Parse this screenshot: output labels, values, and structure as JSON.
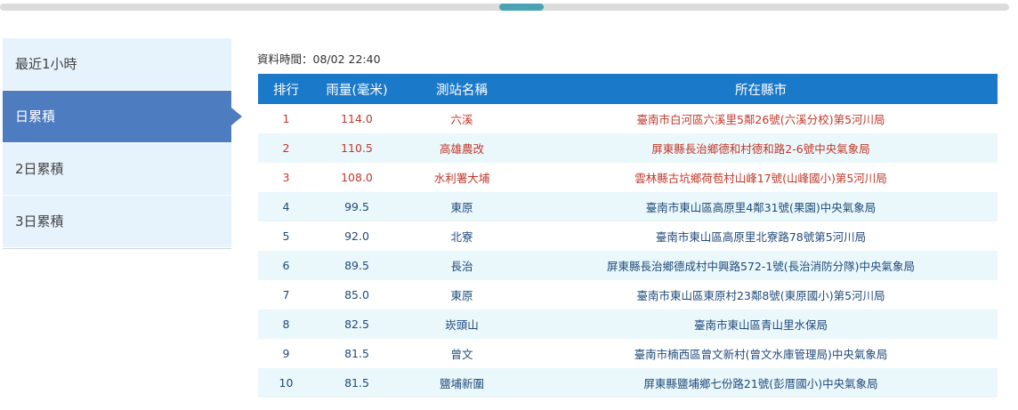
{
  "sidebar": {
    "items": [
      {
        "label": "最近1小時",
        "active": false
      },
      {
        "label": "日累積",
        "active": true
      },
      {
        "label": "2日累積",
        "active": false
      },
      {
        "label": "3日累積",
        "active": false
      }
    ]
  },
  "data_time": "資料時間：08/02 22:40",
  "table": {
    "headers": [
      "排行",
      "雨量(毫米)",
      "測站名稱",
      "所在縣市"
    ],
    "rows": [
      {
        "rank": "1",
        "rain": "114.0",
        "station": "六溪",
        "location": "臺南市白河區六溪里5鄰26號(六溪分校)第5河川局",
        "highlight": true
      },
      {
        "rank": "2",
        "rain": "110.5",
        "station": "高雄農改",
        "location": "屏東縣長治鄉德和村德和路2-6號中央氣象局",
        "highlight": true
      },
      {
        "rank": "3",
        "rain": "108.0",
        "station": "水利署大埔",
        "location": "雲林縣古坑鄉荷苞村山峰17號(山峰國小)第5河川局",
        "highlight": true
      },
      {
        "rank": "4",
        "rain": "99.5",
        "station": "東原",
        "location": "臺南市東山區高原里4鄰31號(果園)中央氣象局",
        "highlight": false
      },
      {
        "rank": "5",
        "rain": "92.0",
        "station": "北寮",
        "location": "臺南市東山區高原里北寮路78號第5河川局",
        "highlight": false
      },
      {
        "rank": "6",
        "rain": "89.5",
        "station": "長治",
        "location": "屏東縣長治鄉德成村中興路572-1號(長治消防分隊)中央氣象局",
        "highlight": false
      },
      {
        "rank": "7",
        "rain": "85.0",
        "station": "東原",
        "location": "臺南市東山區東原村23鄰8號(東原國小)第5河川局",
        "highlight": false
      },
      {
        "rank": "8",
        "rain": "82.5",
        "station": "崁頭山",
        "location": "臺南市東山區青山里水保局",
        "highlight": false
      },
      {
        "rank": "9",
        "rain": "81.5",
        "station": "曾文",
        "location": "臺南市楠西區曾文新村(曾文水庫管理局)中央氣象局",
        "highlight": false
      },
      {
        "rank": "10",
        "rain": "81.5",
        "station": "鹽埔新圍",
        "location": "屏東縣鹽埔鄉七份路21號(彭厝國小)中央氣象局",
        "highlight": false
      }
    ]
  }
}
